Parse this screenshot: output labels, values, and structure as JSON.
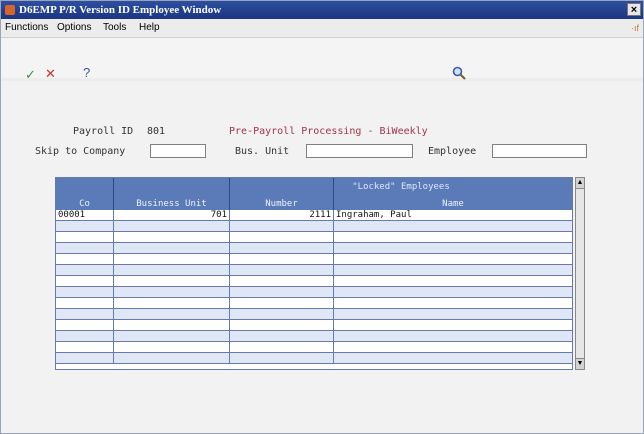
{
  "window": {
    "title": "D6EMP P/R Version ID Employee Window",
    "close_glyph": "×"
  },
  "menu": [
    {
      "label": "Functions"
    },
    {
      "label": "Options"
    },
    {
      "label": "Tools"
    },
    {
      "label": "Help"
    }
  ],
  "menu_right": "·ıf",
  "toolbar": {
    "ok_glyph": "✓",
    "cancel_glyph": "✕",
    "help_glyph": "?"
  },
  "header": {
    "payroll_id_label": "Payroll ID",
    "payroll_id_value": "801",
    "process_title": "Pre-Payroll Processing - BiWeekly",
    "skip_company_label": "Skip to Company",
    "skip_company_value": "",
    "bus_unit_label": "Bus. Unit",
    "bus_unit_value": "",
    "employee_label": "Employee",
    "employee_value": ""
  },
  "grid": {
    "title": "\"Locked\" Employees",
    "columns": [
      "Co",
      "Business Unit",
      "Number",
      "Name"
    ],
    "rows": [
      [
        "00001",
        "701",
        "2111",
        "Ingraham, Paul"
      ],
      [
        "",
        "",
        "",
        ""
      ],
      [
        "",
        "",
        "",
        ""
      ],
      [
        "",
        "",
        "",
        ""
      ],
      [
        "",
        "",
        "",
        ""
      ],
      [
        "",
        "",
        "",
        ""
      ],
      [
        "",
        "",
        "",
        ""
      ],
      [
        "",
        "",
        "",
        ""
      ],
      [
        "",
        "",
        "",
        ""
      ],
      [
        "",
        "",
        "",
        ""
      ],
      [
        "",
        "",
        "",
        ""
      ],
      [
        "",
        "",
        "",
        ""
      ],
      [
        "",
        "",
        "",
        ""
      ],
      [
        "",
        "",
        "",
        ""
      ]
    ]
  }
}
